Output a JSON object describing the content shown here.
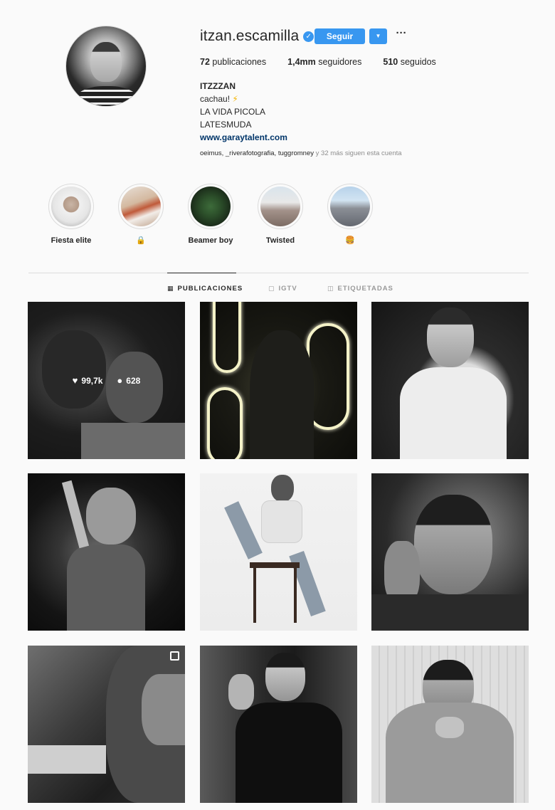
{
  "profile": {
    "username": "itzan.escamilla",
    "verified_glyph": "✓",
    "follow_label": "Seguir",
    "caret_glyph": "▼",
    "more_glyph": "···",
    "stats": {
      "posts_count": "72",
      "posts_label": "publicaciones",
      "followers_count": "1,4mm",
      "followers_label": "seguidores",
      "following_count": "510",
      "following_label": "seguidos"
    },
    "bio": {
      "name": "ITZZZAN",
      "line1": "cachau!",
      "bolt": "⚡",
      "line2": "LA VIDA PICOLA",
      "line3": "LATESMUDA",
      "link": "www.garaytalent.com"
    },
    "followed_by": {
      "names": "oeimus, _riverafotografia, tuggromney",
      "rest": "y 32 más siguen esta cuenta"
    }
  },
  "highlights": [
    {
      "label": "Fiesta elite"
    },
    {
      "label": "🔒"
    },
    {
      "label": "Beamer boy"
    },
    {
      "label": "Twisted"
    },
    {
      "label": "🍔"
    }
  ],
  "tabs": [
    {
      "icon": "▦",
      "label": "PUBLICACIONES"
    },
    {
      "icon": "▢",
      "label": "IGTV"
    },
    {
      "icon": "◫",
      "label": "ETIQUETADAS"
    }
  ],
  "hovered_post": {
    "likes": "99,7k",
    "comments": "628",
    "heart_glyph": "♥",
    "comment_glyph": "●"
  },
  "colors": {
    "accent": "#3897f0",
    "link": "#003569",
    "text": "#262626",
    "muted": "#8e8e8e"
  }
}
